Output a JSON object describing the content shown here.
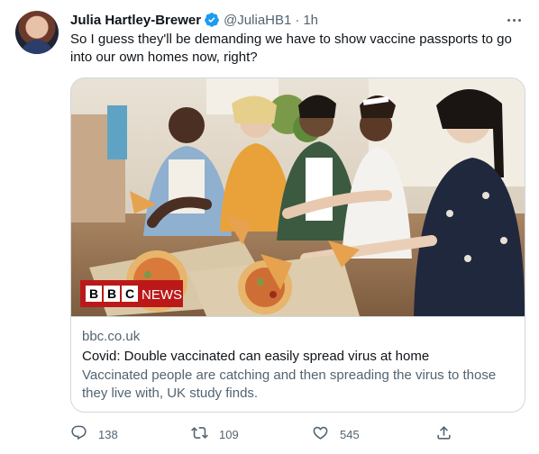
{
  "author": {
    "name": "Julia Hartley-Brewer",
    "handle": "@JuliaHB1",
    "separator": "·",
    "time": "1h"
  },
  "tweet_text": "So I guess they'll be demanding we have to show vaccine passports to go into our own homes now, right?",
  "link_card": {
    "image_badge": {
      "logo": "BBC",
      "label": "NEWS"
    },
    "domain": "bbc.co.uk",
    "headline": "Covid: Double vaccinated can easily spread virus at home",
    "description": "Vaccinated people are catching and then spreading the virus to those they live with, UK study finds."
  },
  "actions": {
    "reply_count": "138",
    "retweet_count": "109",
    "like_count": "545"
  },
  "icons": {
    "verified": "verified-badge-icon",
    "more": "more-options-icon",
    "reply": "reply-icon",
    "retweet": "retweet-icon",
    "like": "heart-icon",
    "share": "share-icon"
  },
  "colors": {
    "text_primary": "#0f1419",
    "text_secondary": "#536471",
    "verified_blue": "#1d9bf0",
    "border": "#cfd9de",
    "bbc_red": "#bb1919"
  }
}
